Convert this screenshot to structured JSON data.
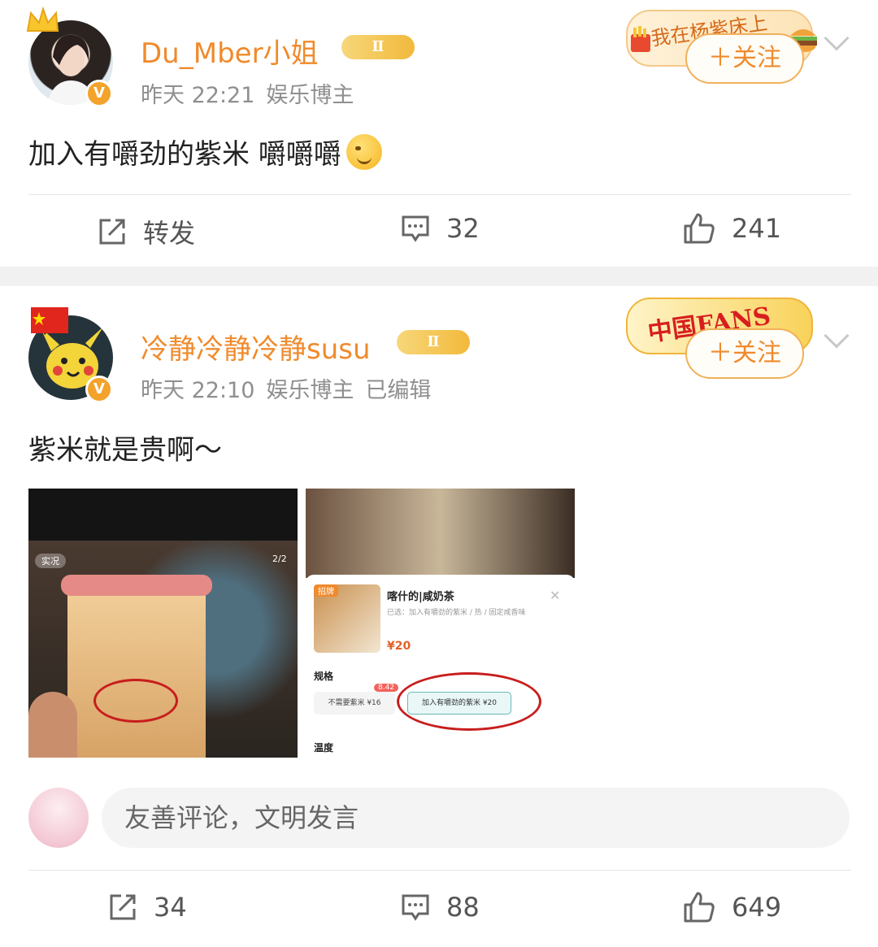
{
  "posts": [
    {
      "username": "Du_Mber小姐",
      "level_badge": "Ⅱ",
      "time": "昨天 22:21",
      "role": "娱乐博主",
      "text": "加入有嚼劲的紫米 嚼嚼嚼",
      "follow_label": "＋关注",
      "follow_deco_text": "我在杨紫床上",
      "actions": {
        "repost": "转发",
        "comments": "32",
        "likes": "241"
      }
    },
    {
      "username": "冷静冷静冷静susu",
      "level_badge": "Ⅱ",
      "time": "昨天 22:10",
      "role": "娱乐博主",
      "edited": "已编辑",
      "text": "紫米就是贵啊～",
      "follow_label": "＋关注",
      "follow_deco_text": "中国FANS",
      "image1": {
        "live_label": "实况",
        "page": "2/2"
      },
      "image2": {
        "product_tag": "招牌",
        "product_name": "喀什的|咸奶茶",
        "selected": "已选：加入有嚼劲的紫米 / 热 / 固定咸香味",
        "price": "¥20",
        "spec_label": "规格",
        "option1": "不需要紫米 ¥16",
        "option2_tag": "8.42",
        "option2": "加入有嚼劲的紫米 ¥20",
        "temp_label": "温度"
      },
      "comment_placeholder": "友善评论，文明发言",
      "actions": {
        "reposts": "34",
        "comments": "88",
        "likes": "649"
      }
    }
  ]
}
